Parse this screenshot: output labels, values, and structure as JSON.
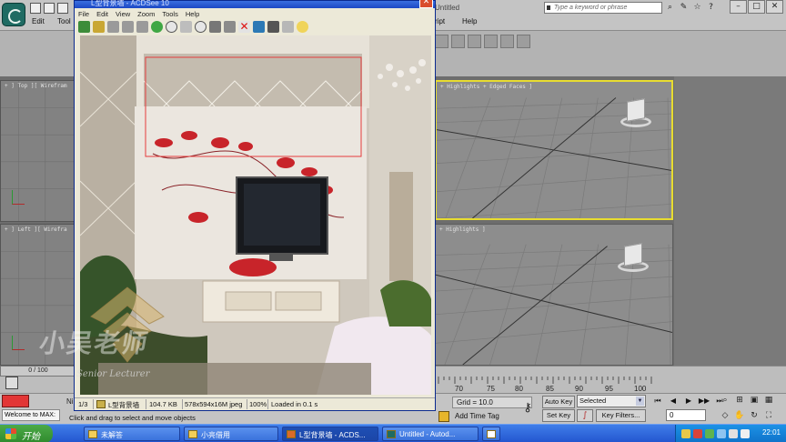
{
  "max": {
    "title": "Untitled",
    "menu": [
      "Edit",
      "Tool",
      "ript",
      "Help"
    ],
    "search_placeholder": "Type a keyword or phrase",
    "viewports": {
      "top_left": "+ ] Top ][ Wirefram",
      "bottom_left": "+ ] Left ][ Wirefra",
      "top_right": "+ Highlights + Edged Faces ]",
      "bottom_right": "+ Highlights ]"
    },
    "frame_counter": "0 / 100",
    "ruler_ticks": [
      "70",
      "75",
      "80",
      "85",
      "90",
      "95",
      "100"
    ],
    "grid_value": "Grid = 10.0",
    "add_time_tag": "Add Time Tag",
    "auto_key": "Auto Key",
    "set_key": "Set Key",
    "selected_option": "Selected",
    "key_filters": "Key Filters...",
    "current_frame": "0",
    "welcome": "Welcome to MAX:",
    "prompt": "Click and drag to select and move objects",
    "n_label": "Ni"
  },
  "viewer": {
    "title": "L型背景墙 - ACDSee 10",
    "menu": [
      "File",
      "Edit",
      "View",
      "Zoom",
      "Tools",
      "Help"
    ],
    "status": {
      "index": "1/3",
      "filename": "L型背景墙",
      "size": "104.7 KB",
      "dims": "578x594x16M jpeg",
      "zoom": "100%",
      "loaded": "Loaded in 0.1 s"
    }
  },
  "watermark": {
    "cn": "小吴老师",
    "en": "Senior Lecturer"
  },
  "taskbar": {
    "start": "开始",
    "items": [
      "未解答",
      "小亮借用",
      "L型背景墙 - ACDS...",
      "Untitled - Autod..."
    ],
    "clock": "22:01"
  },
  "colors": {
    "viewport_active_border": "#e8dc30",
    "xp_blue": "#2456d0",
    "start_green": "#3c9b3a"
  }
}
